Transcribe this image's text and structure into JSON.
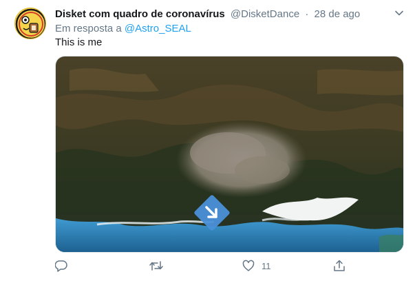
{
  "tweet": {
    "display_name": "Disket com quadro de coronavírus",
    "handle": "@DisketDance",
    "separator": "·",
    "timestamp": "28 de ago",
    "reply_prefix": "Em resposta a",
    "reply_mention": "@Astro_SEAL",
    "body": "This is me"
  },
  "media": {
    "type": "satellite-photo",
    "overlay_icon": "arrow-down-right-diamond-icon"
  },
  "actions": {
    "reply_icon": "reply-icon",
    "retweet_icon": "retweet-icon",
    "like_icon": "heart-icon",
    "like_count": "11",
    "share_icon": "share-icon"
  },
  "colors": {
    "link": "#1da1f2",
    "muted": "#657786",
    "text": "#14171a",
    "marker": "#4a90d9"
  }
}
